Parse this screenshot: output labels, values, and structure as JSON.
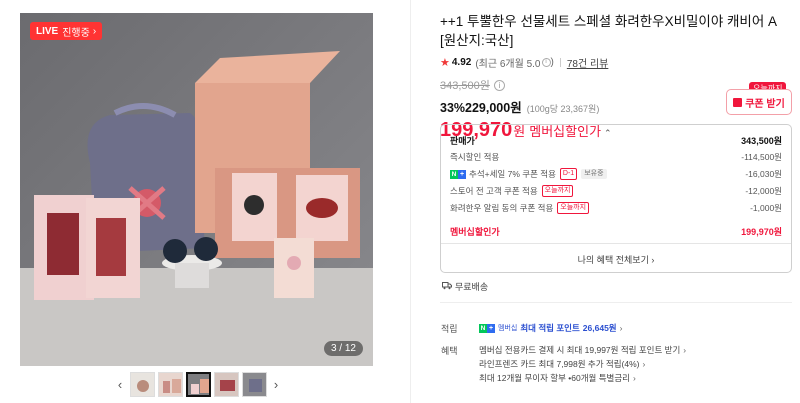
{
  "gallery": {
    "live_tag": "LIVE",
    "live_text": "진행중",
    "page_counter": "3 / 12",
    "thumbnails": [
      "thumb-1",
      "thumb-2",
      "thumb-3",
      "thumb-4",
      "thumb-5"
    ],
    "active_thumb": 3
  },
  "product": {
    "title": "++1 투뿔한우 선물세트 스페셜 화려한우X비밀이야 캐비어 A [원산지:국산]",
    "rating": "4.92",
    "rating_sub": "(최근 6개월 5.0",
    "reviews": "78건 리뷰",
    "original_price": "343,500원",
    "discount_pct": "33%",
    "discount_price": "229,000원",
    "unit_price": "(100g당 23,367원)",
    "member_price": "199,970",
    "member_won": "원",
    "member_label": "멤버십할인가",
    "coupon_today": "오늘까지",
    "coupon_label": "쿠폰 받기"
  },
  "breakdown": {
    "header_label": "판매가",
    "header_value": "343,500원",
    "rows": [
      {
        "label": "즉시할인 적용",
        "value": "-114,500원"
      },
      {
        "label": "추석+세일 7% 쿠폰 적용",
        "tag": "D-1",
        "tag2": "보유중",
        "value": "-16,030원"
      },
      {
        "label": "스토어 전 고객 쿠폰 적용",
        "tag": "오늘까지",
        "value": "-12,000원"
      },
      {
        "label": "화려한우 알림 동의 쿠폰 적용",
        "tag": "오늘까지",
        "value": "-1,000원"
      }
    ],
    "total_label": "멤버십할인가",
    "total_value": "199,970원",
    "benefit_link": "나의 혜택 전체보기"
  },
  "shipping": "무료배송",
  "earn": {
    "label": "적립",
    "prefix": "멤버십",
    "text": "최대 적립 포인트",
    "points": "26,645원"
  },
  "benefits": {
    "label": "혜택",
    "lines": [
      "멤버십 전용카드 결제 시 최대 19,997원 적립 포인트 받기",
      "라인프렌즈 카드 최대 7,998원 추가 적립(4%)",
      "최대 12개월 무이자 할부 •60개월 특별금리"
    ]
  },
  "colors": {
    "accent": "#f0163c",
    "naver_green": "#03c75a",
    "point_blue": "#2b4fd0"
  }
}
